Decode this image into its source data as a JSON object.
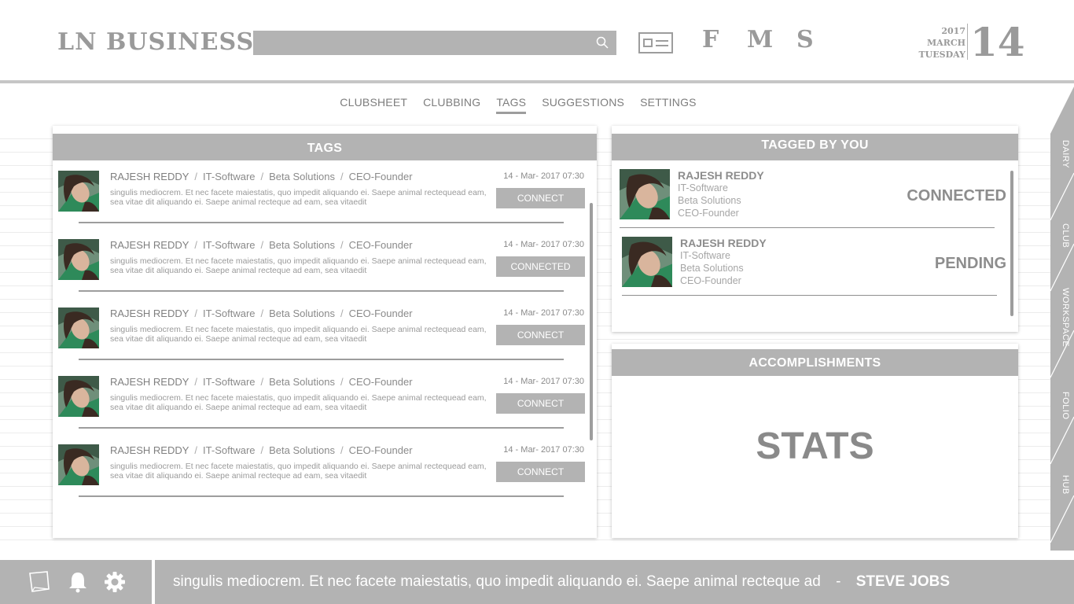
{
  "header": {
    "logo": "LN BUSINESS",
    "search_placeholder": "",
    "shortcuts": [
      "F",
      "M",
      "S"
    ],
    "date": {
      "year": "2017",
      "month": "MARCH",
      "weekday": "TUESDAY",
      "day": "14"
    }
  },
  "nav": {
    "items": [
      "CLUBSHEET",
      "CLUBBING",
      "TAGS",
      "SUGGESTIONS",
      "SETTINGS"
    ],
    "active": "TAGS"
  },
  "tags": {
    "title": "TAGS",
    "items": [
      {
        "name": "RAJESH REDDY",
        "industry": "IT-Software",
        "company": "Beta Solutions",
        "role": "CEO-Founder",
        "time": "14 - Mar- 2017  07:30",
        "desc": "singulis mediocrem. Et nec facete maiestatis, quo impedit aliquando ei. Saepe animal rectequead eam, sea vitae dit aliquando ei. Saepe animal recteque ad eam, sea vitaedit",
        "button": "CONNECT"
      },
      {
        "name": "RAJESH REDDY",
        "industry": "IT-Software",
        "company": "Beta Solutions",
        "role": "CEO-Founder",
        "time": "14 - Mar- 2017  07:30",
        "desc": "singulis mediocrem. Et nec facete maiestatis, quo impedit aliquando ei. Saepe animal rectequead eam, sea vitae dit aliquando ei. Saepe animal recteque ad eam, sea vitaedit",
        "button": "CONNECTED"
      },
      {
        "name": "RAJESH REDDY",
        "industry": "IT-Software",
        "company": "Beta Solutions",
        "role": "CEO-Founder",
        "time": "14 - Mar- 2017  07:30",
        "desc": "singulis mediocrem. Et nec facete maiestatis, quo impedit aliquando ei. Saepe animal rectequead eam, sea vitae dit aliquando ei. Saepe animal recteque ad eam, sea vitaedit",
        "button": "CONNECT"
      },
      {
        "name": "RAJESH REDDY",
        "industry": "IT-Software",
        "company": "Beta Solutions",
        "role": "CEO-Founder",
        "time": "14 - Mar- 2017  07:30",
        "desc": "singulis mediocrem. Et nec facete maiestatis, quo impedit aliquando ei. Saepe animal rectequead eam, sea vitae dit aliquando ei. Saepe animal recteque ad eam, sea vitaedit",
        "button": "CONNECT"
      },
      {
        "name": "RAJESH REDDY",
        "industry": "IT-Software",
        "company": "Beta Solutions",
        "role": "CEO-Founder",
        "time": "14 - Mar- 2017  07:30",
        "desc": "singulis mediocrem. Et nec facete maiestatis, quo impedit aliquando ei. Saepe animal rectequead eam, sea vitae dit aliquando ei. Saepe animal recteque ad eam, sea vitaedit",
        "button": "CONNECT"
      }
    ]
  },
  "tagged_by_you": {
    "title": "TAGGED BY YOU",
    "items": [
      {
        "name": "RAJESH REDDY",
        "industry": "IT-Software",
        "company": "Beta Solutions",
        "role": "CEO-Founder",
        "status": "CONNECTED"
      },
      {
        "name": "RAJESH REDDY",
        "industry": "IT-Software",
        "company": "Beta Solutions",
        "role": "CEO-Founder",
        "status": "PENDING"
      }
    ]
  },
  "accomplishments": {
    "title": "ACCOMPLISHMENTS",
    "body": "STATS"
  },
  "side_tabs": [
    "DAIRY",
    "CLUB",
    "WORKSPACE",
    "FOLIO",
    "HUB"
  ],
  "footer": {
    "icons": [
      "notes-icon",
      "bell-icon",
      "gear-icon"
    ],
    "quote": "singulis mediocrem. Et nec facete maiestatis, quo impedit aliquando ei. Saepe animal recteque ad",
    "dash": "-",
    "author": "STEVE JOBS"
  },
  "colors": {
    "accent": "#b3b3b3",
    "text": "#8a8a8a",
    "rule": "#9d9d9d"
  }
}
